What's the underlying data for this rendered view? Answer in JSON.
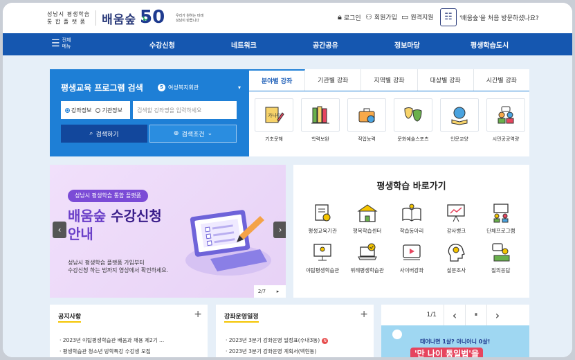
{
  "header": {
    "logo_line1": "성남시 평생학습",
    "logo_line2": "통 합 플 랫 폼",
    "logo_main": "배움숲",
    "anniv_number": "50",
    "anniv_caption_1": "우리가 원하는 미래",
    "anniv_caption_2": "성남이 만듭니다",
    "login": "로그인",
    "signup": "회원가입",
    "remote": "원격지원",
    "welcome": "'배움숲'을 처음 방문하셨나요?"
  },
  "nav": {
    "menu_label_1": "전체",
    "menu_label_2": "메뉴",
    "items": [
      "수강신청",
      "네트워크",
      "공간공유",
      "정보마당",
      "평생학습도시"
    ]
  },
  "search": {
    "title": "평생교육 프로그램 검색",
    "org": "여성복지회관",
    "radio_course": "강좌정보",
    "radio_org": "기관정보",
    "placeholder": "검색할 강좌명을 입력하세요",
    "btn_search": "검색하기",
    "btn_condition": "검색조건"
  },
  "category_tabs": [
    "분야별 강좌",
    "기관별 강좌",
    "지역별 강좌",
    "대상별 강좌",
    "시간별 강좌"
  ],
  "categories": [
    "기초문해",
    "학력보완",
    "직업능력",
    "문화예술스포츠",
    "인문교양",
    "시민공공역량"
  ],
  "banner": {
    "pill": "성남시 평생학습 통합 플랫폼",
    "headline_a": "배움숲",
    "headline_b": "수강신청",
    "headline_c": "안내",
    "desc_1": "성남시 평생학습 플랫폼 가입부터",
    "desc_2": "수강신청 하는 법까지 영상에서 확인하세요.",
    "pager": "2/7",
    "next": "▸"
  },
  "quick": {
    "title": "평생학습 바로가기",
    "items": [
      "평생교육기관",
      "행복학습센터",
      "학습동아리",
      "강사뱅크",
      "단체프로그램",
      "야탑평생학습관",
      "위례평생학습관",
      "사이버강좌",
      "설문조사",
      "질의응답"
    ]
  },
  "notice": {
    "title": "공지사항",
    "items": [
      "2023년 야탑평생학습관 배움과 채용 제2기 ...",
      "평생학습관 청소년 방학특강 수강생 모집"
    ]
  },
  "schedule": {
    "title": "강좌운영일정",
    "items": [
      "2023년 3분기 강좌운영 일정표(수내3동)",
      "2023년 3분기 강좌운영 계획서(백현동)"
    ],
    "new_badge": "N"
  },
  "promo": {
    "pager": "1/1",
    "prev": "‹",
    "pause": "⏸",
    "next": "›",
    "text_1": "태어나면 1살? 아니아니 0살!",
    "text_2": "'만 나이 통일법'을"
  }
}
